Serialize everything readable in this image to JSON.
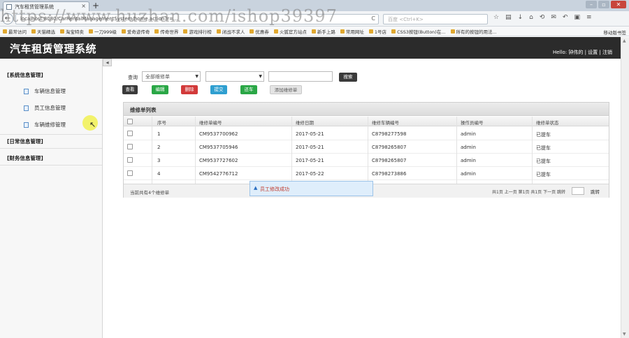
{
  "browser": {
    "tab_title": "汽车租赁管理系统",
    "url": "localhost:8080/CarRentalManagementSystem/home.action?r=...",
    "search_placeholder": "百度 <Ctrl+K>",
    "bookmarks": [
      "最常访问",
      "天猫精选",
      "淘宝特卖",
      "一刀999级",
      "爱奇迹传奇",
      "传奇世界",
      "游戏排行榜",
      "闭战不求人",
      "优惠券",
      "火狐官方站点",
      "新手上路",
      "常用网址",
      "1号店",
      "CSS3按钮(Button)在...",
      "所有的按钮的用法..."
    ],
    "bookmarks_right": "移动版书签",
    "new_tab": "+"
  },
  "watermark": "https://www.huzhan.com/ishop39397",
  "header": {
    "title": "汽车租赁管理系统",
    "hello_prefix": "Hello:",
    "username": "钟伟的",
    "sep1": "|",
    "settings": "设置",
    "sep2": "|",
    "logout": "注销"
  },
  "sidebar": {
    "collapse": "◂",
    "groups": [
      {
        "label": "[系统信息管理]"
      },
      {
        "label": "[日常信息管理]"
      },
      {
        "label": "[财务信息管理]"
      }
    ],
    "items": [
      {
        "label": "车辆信息管理"
      },
      {
        "label": "员工信息管理"
      },
      {
        "label": "车辆维修管理"
      }
    ]
  },
  "toolbar": {
    "query_label": "查询",
    "select1_value": "全部维修单",
    "select2_value": "",
    "search_btn": "搜索",
    "view_btn": "查看",
    "edit_btn": "编辑",
    "delete_btn": "删除",
    "submit_btn": "提交",
    "return_btn": "还车",
    "add_btn": "添加维修单"
  },
  "table": {
    "title": "维修单列表",
    "headers": [
      "序号",
      "维修单编号",
      "维修日期",
      "维修车辆编号",
      "操作员编号",
      "维修单状态"
    ],
    "rows": [
      {
        "no": "1",
        "id": "CM9537700962",
        "date": "2017-05-21",
        "car": "C8798277598",
        "op": "admin",
        "status": "已提车"
      },
      {
        "no": "2",
        "id": "CM9537705946",
        "date": "2017-05-21",
        "car": "C8798265807",
        "op": "admin",
        "status": "已提车"
      },
      {
        "no": "3",
        "id": "CM9537727602",
        "date": "2017-05-21",
        "car": "C8798265807",
        "op": "admin",
        "status": "已提车"
      },
      {
        "no": "4",
        "id": "CM9542776712",
        "date": "2017-05-22",
        "car": "C8798273886",
        "op": "admin",
        "status": "已提车"
      }
    ],
    "footer_left": "当前共有4个维修单",
    "footer_right": "共1页 上一页 第1页 共1页 下一页 跳转",
    "jump": "跳转"
  },
  "toast": {
    "message": "员工修改成功",
    "icon": "▲"
  },
  "colors": {
    "header_bg": "#2b2b2b",
    "btn_green": "#2aa746",
    "btn_red": "#d23a3a",
    "btn_blue": "#2f9fd0"
  }
}
